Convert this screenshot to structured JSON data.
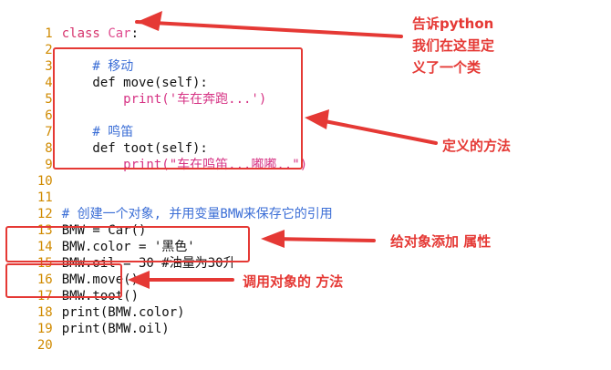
{
  "code": {
    "lines": [
      {
        "n": "1",
        "t": "class Car:"
      },
      {
        "n": "2",
        "t": ""
      },
      {
        "n": "3",
        "t": "    # 移动"
      },
      {
        "n": "4",
        "t": "    def move(self):"
      },
      {
        "n": "5",
        "t": "        print('车在奔跑...')"
      },
      {
        "n": "6",
        "t": ""
      },
      {
        "n": "7",
        "t": "    # 鸣笛"
      },
      {
        "n": "8",
        "t": "    def toot(self):"
      },
      {
        "n": "9",
        "t": "        print(\"车在鸣笛...嘟嘟..\")"
      },
      {
        "n": "10",
        "t": ""
      },
      {
        "n": "11",
        "t": ""
      },
      {
        "n": "12",
        "t": "# 创建一个对象, 并用变量BMW来保存它的引用"
      },
      {
        "n": "13",
        "t": "BMW = Car()"
      },
      {
        "n": "14",
        "t": "BMW.color = '黑色'"
      },
      {
        "n": "15",
        "t": "BMW.oil = 30 #油量为30升"
      },
      {
        "n": "16",
        "t": "BMW.move()"
      },
      {
        "n": "17",
        "t": "BMW.toot()"
      },
      {
        "n": "18",
        "t": "print(BMW.color)"
      },
      {
        "n": "19",
        "t": "print(BMW.oil)"
      },
      {
        "n": "20",
        "t": ""
      }
    ]
  },
  "annotations": {
    "class_note_line1": "告诉python",
    "class_note_line2": "我们在这里定",
    "class_note_line3": "义了一个类",
    "method_note": "定义的方法",
    "attr_note": "给对象添加 属性",
    "call_note": "调用对象的 方法"
  },
  "colors": {
    "annotation": "#e53935",
    "line_number": "#d08a00",
    "comment": "#3b6ed6",
    "string": "#d63384"
  }
}
